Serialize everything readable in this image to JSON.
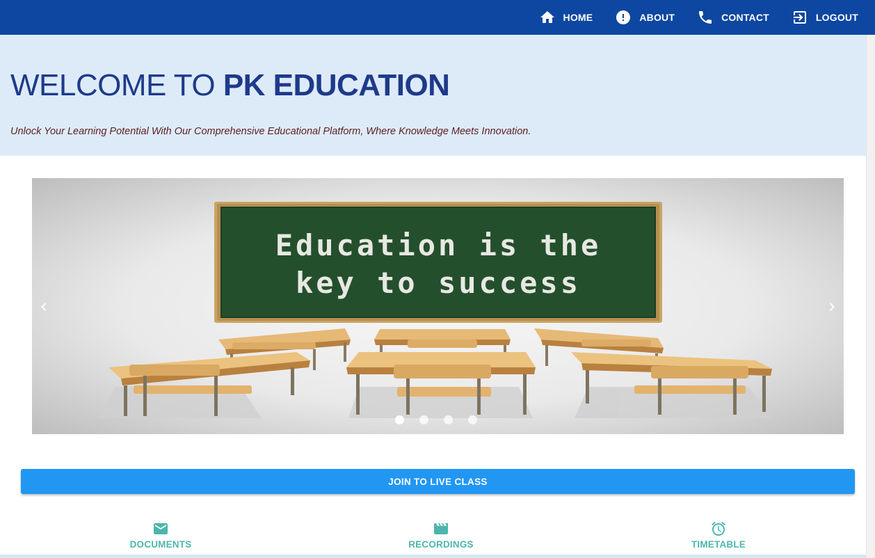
{
  "nav": {
    "items": [
      {
        "label": "HOME",
        "icon": "home-icon"
      },
      {
        "label": "ABOUT",
        "icon": "info-icon"
      },
      {
        "label": "CONTACT",
        "icon": "phone-icon"
      },
      {
        "label": "LOGOUT",
        "icon": "logout-icon"
      }
    ]
  },
  "hero": {
    "title_light": "WELCOME TO ",
    "title_bold": "PK EDUCATION",
    "subtitle": "Unlock Your Learning Potential With Our Comprehensive Educational Platform, Where Knowledge Meets Innovation."
  },
  "carousel": {
    "slide_text_line1": "Education is the",
    "slide_text_line2": "key to success",
    "slide_count": 4,
    "active_slide": 1
  },
  "join_button": {
    "label": "JOIN TO LIVE CLASS"
  },
  "tabs": [
    {
      "label": "DOCUMENTS",
      "icon": "email-icon"
    },
    {
      "label": "RECORDINGS",
      "icon": "clapperboard-icon"
    },
    {
      "label": "TIMETABLE",
      "icon": "alarm-clock-icon"
    }
  ],
  "colors": {
    "nav_bg": "#0d47a1",
    "hero_bg": "#ddebf9",
    "title_color": "#1e3a8a",
    "button_bg": "#2196f3",
    "tab_color": "#4db6ac"
  }
}
